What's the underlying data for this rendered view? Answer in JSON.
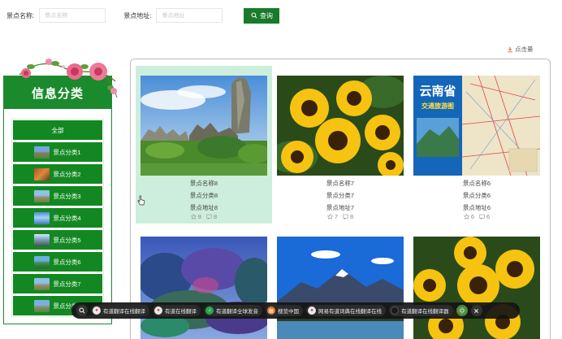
{
  "search": {
    "name_label": "景点名称:",
    "name_placeholder": "景点名称",
    "address_label": "景点地址:",
    "address_placeholder": "景点地址",
    "button_label": "查询"
  },
  "sort": {
    "label": "点击量"
  },
  "sidebar": {
    "title": "信息分类",
    "items": [
      {
        "label": "全部"
      },
      {
        "label": "景点分类1"
      },
      {
        "label": "景点分类2"
      },
      {
        "label": "景点分类3"
      },
      {
        "label": "景点分类4"
      },
      {
        "label": "景点分类5"
      },
      {
        "label": "景点分类6"
      },
      {
        "label": "景点分类7"
      },
      {
        "label": "景点分类8"
      }
    ]
  },
  "cards": [
    {
      "name": "景点名称8",
      "category": "景点分类8",
      "address": "景点地址8",
      "likes": "8",
      "comments": "8"
    },
    {
      "name": "景点名称7",
      "category": "景点分类7",
      "address": "景点地址7",
      "likes": "7",
      "comments": "8"
    },
    {
      "name": "景点名称6",
      "category": "景点分类6",
      "address": "景点地址6",
      "likes": "6",
      "comments": "6"
    }
  ],
  "map_image": {
    "title": "云南省",
    "subtitle": "交通旅游图"
  },
  "toolbar": {
    "items": [
      {
        "label": "有道翻译在线翻译"
      },
      {
        "label": "有道在线翻译"
      },
      {
        "label": "有道翻译全球发音"
      },
      {
        "label": "搜览中国"
      },
      {
        "label": "网易有道词典在线翻译在线"
      },
      {
        "label": "有道翻译在线翻译器"
      }
    ]
  },
  "colors": {
    "brand_green": "#1a7a2c",
    "active_card": "#cdeedd"
  }
}
